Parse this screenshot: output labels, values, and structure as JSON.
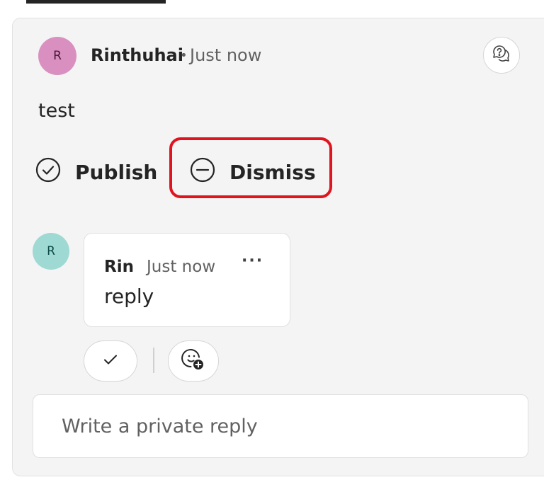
{
  "comment": {
    "avatar_initial": "R",
    "author": "Rinthuhai",
    "separator": "•",
    "timestamp": "Just now",
    "body": "test",
    "actions": {
      "publish_label": "Publish",
      "dismiss_label": "Dismiss"
    }
  },
  "reply": {
    "avatar_initial": "R",
    "author": "Rin",
    "timestamp": "Just now",
    "more_label": "···",
    "text": "reply"
  },
  "composer": {
    "placeholder": "Write a private reply",
    "value": ""
  },
  "icons": {
    "convert": "question-chat-icon",
    "publish": "check-circle-icon",
    "dismiss": "minus-circle-icon",
    "resolve": "checkmark-icon",
    "reaction": "add-emoji-icon"
  },
  "colors": {
    "highlight": "#e0141e",
    "main_avatar": "#d990c0",
    "reply_avatar": "#9ed9d4",
    "card_background": "#f4f4f4"
  }
}
